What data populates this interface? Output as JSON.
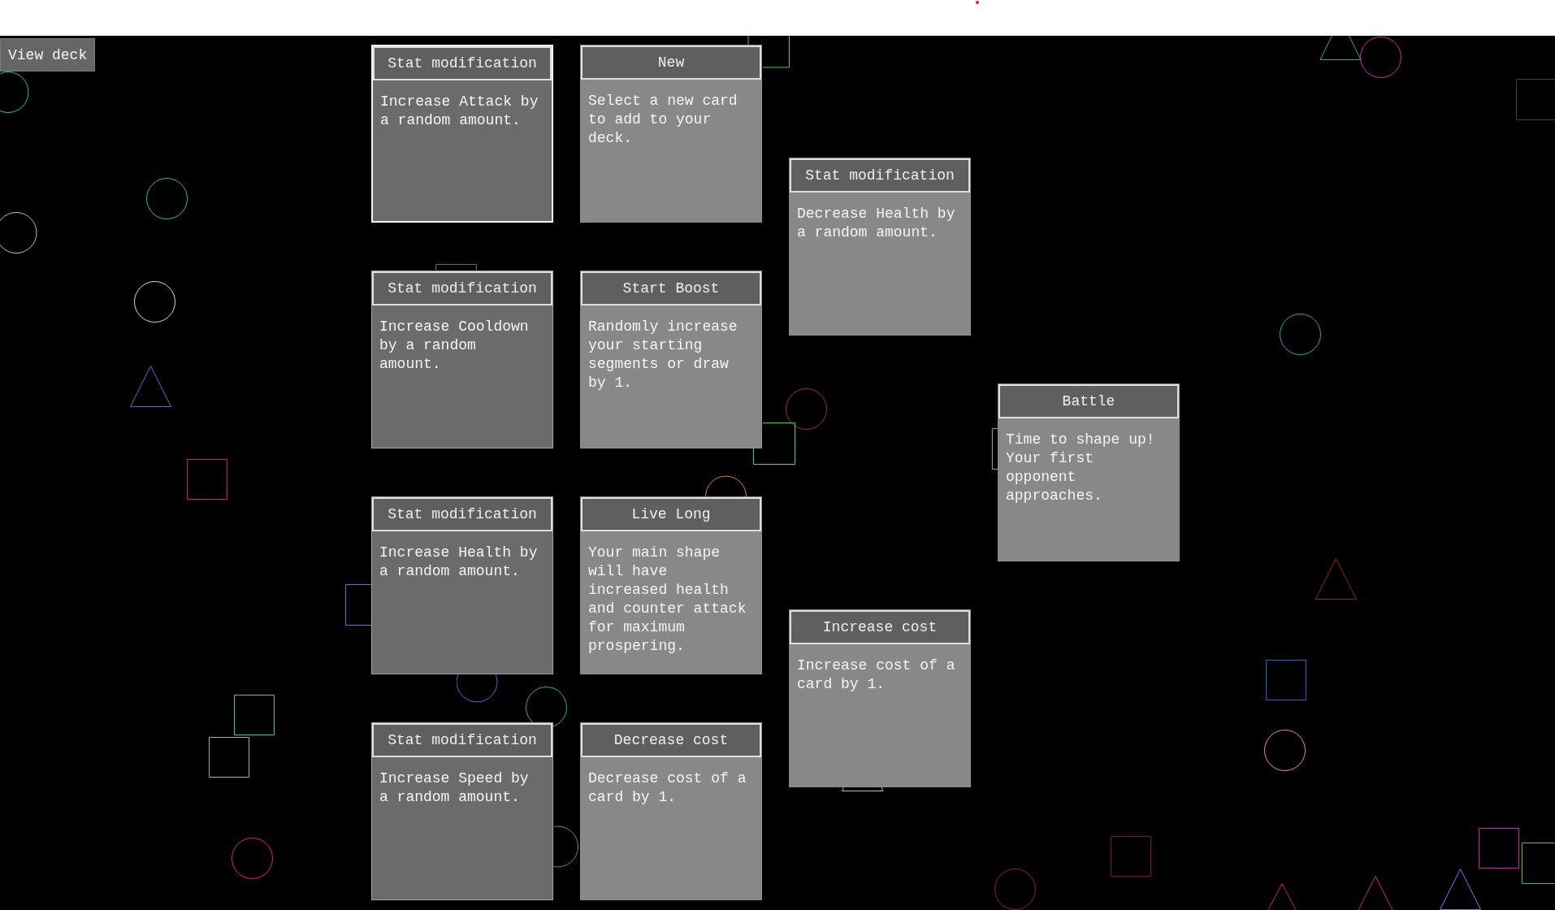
{
  "view_deck_button": {
    "label": "View deck"
  },
  "map": {
    "columns": [
      {
        "cards": [
          {
            "title": "Stat modification",
            "description": "Increase Attack by a random amount.",
            "available": true,
            "selected": true
          },
          {
            "title": "Stat modification",
            "description": "Increase Cooldown by a random amount.",
            "available": true,
            "selected": false
          },
          {
            "title": "Stat modification",
            "description": "Increase Health by a random amount.",
            "available": true,
            "selected": false
          },
          {
            "title": "Stat modification",
            "description": "Increase Speed by a random amount.",
            "available": true,
            "selected": false
          }
        ]
      },
      {
        "cards": [
          {
            "title": "New",
            "description": "Select a new card to add to your deck.",
            "available": false,
            "selected": false
          },
          {
            "title": "Start Boost",
            "description": "Randomly increase your starting segments or draw by 1.",
            "available": false,
            "selected": false
          },
          {
            "title": "Live Long",
            "description": "Your main shape will have increased health and counter attack for maximum prospering.",
            "available": false,
            "selected": false
          },
          {
            "title": "Decrease cost",
            "description": "Decrease cost of a card by 1.",
            "available": false,
            "selected": false
          }
        ]
      },
      {
        "cards": [
          {
            "title": "Stat modification",
            "description": "Decrease Health by a random amount.",
            "available": false,
            "selected": false
          },
          {
            "title": "Increase cost",
            "description": "Increase cost of a card by 1.",
            "available": false,
            "selected": false
          }
        ]
      },
      {
        "cards": [
          {
            "title": "Battle",
            "description": "Time to shape up! Your first opponent approaches.",
            "available": false,
            "selected": false
          }
        ]
      }
    ]
  }
}
